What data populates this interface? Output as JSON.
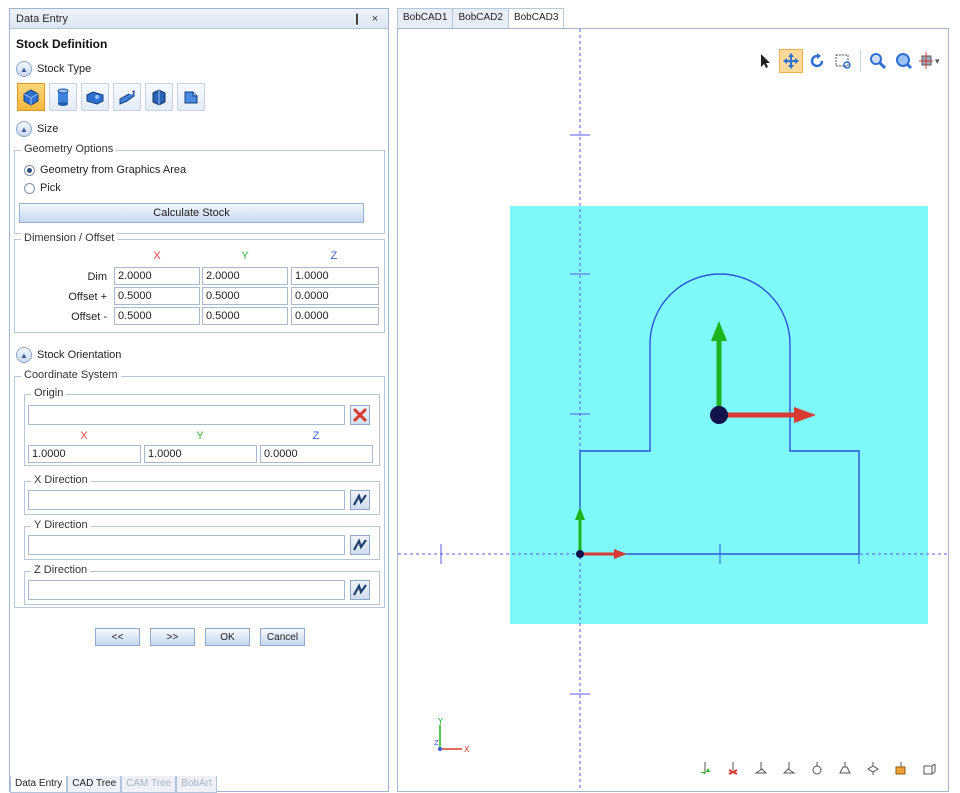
{
  "panel": {
    "title": "Data Entry",
    "pin_label": "❙",
    "close_label": "×",
    "section_title": "Stock Definition",
    "stock_type_label": "Stock Type",
    "stock_types": [
      {
        "name": "block",
        "selected": true
      },
      {
        "name": "cylinder",
        "selected": false
      },
      {
        "name": "extrude",
        "selected": false
      },
      {
        "name": "tube",
        "selected": false
      },
      {
        "name": "stl",
        "selected": false
      },
      {
        "name": "custom",
        "selected": false
      }
    ],
    "size_label": "Size",
    "geometry_options": {
      "legend": "Geometry Options",
      "option_graphics": "Geometry from Graphics Area",
      "option_pick": "Pick",
      "calculate_label": "Calculate Stock"
    },
    "dimension_offset": {
      "legend": "Dimension / Offset",
      "headers": [
        "X",
        "Y",
        "Z"
      ],
      "rows": [
        {
          "label": "Dim",
          "values": [
            "2.0000",
            "2.0000",
            "1.0000"
          ]
        },
        {
          "label": "Offset +",
          "values": [
            "0.5000",
            "0.5000",
            "0.0000"
          ]
        },
        {
          "label": "Offset -",
          "values": [
            "0.5000",
            "0.5000",
            "0.0000"
          ]
        }
      ]
    },
    "stock_orientation_label": "Stock Orientation",
    "coordinate_system": {
      "legend": "Coordinate System",
      "origin": {
        "legend": "Origin",
        "value": "",
        "headers": [
          "X",
          "Y",
          "Z"
        ],
        "values": [
          "1.0000",
          "1.0000",
          "0.0000"
        ]
      },
      "x_direction": {
        "legend": "X Direction",
        "value": ""
      },
      "y_direction": {
        "legend": "Y Direction",
        "value": ""
      },
      "z_direction": {
        "legend": "Z Direction",
        "value": ""
      }
    },
    "nav": {
      "prev": "<<",
      "next": ">>",
      "ok": "OK",
      "cancel": "Cancel"
    },
    "bottom_tabs": [
      "Data Entry",
      "CAD Tree",
      "CAM Tree",
      "BobArt"
    ]
  },
  "view": {
    "tabs": [
      "BobCAD1",
      "BobCAD2",
      "BobCAD3"
    ],
    "active_tab": "BobCAD3",
    "stock_color": "#7ff8f9",
    "profile_color": "#2a56d6",
    "toolbar_icons": [
      "select-icon",
      "pan-icon",
      "rotate-icon",
      "zoom-window-icon",
      "zoom-in-icon",
      "zoom-fit-icon",
      "view-options-icon"
    ],
    "bottom_icons": [
      "view-top-icon",
      "view-bottom-icon",
      "view-left-icon",
      "view-right-icon",
      "view-front-icon",
      "view-back-icon",
      "view-iso-icon",
      "view-shaded-icon",
      "view-wire-icon"
    ],
    "triad": {
      "x": "X",
      "y": "Y",
      "z": "Z"
    }
  }
}
